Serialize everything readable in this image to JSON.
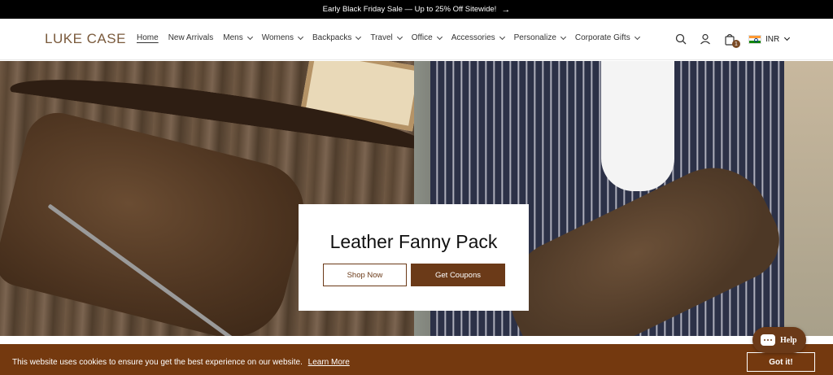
{
  "announcement": {
    "text": "Early Black Friday Sale — Up to 25% Off Sitewide!",
    "arrow": "→"
  },
  "header": {
    "logo": "LUKE CASE",
    "nav": [
      {
        "label": "Home",
        "active": true,
        "dropdown": false
      },
      {
        "label": "New Arrivals",
        "active": false,
        "dropdown": false
      },
      {
        "label": "Mens",
        "active": false,
        "dropdown": true
      },
      {
        "label": "Womens",
        "active": false,
        "dropdown": true
      },
      {
        "label": "Backpacks",
        "active": false,
        "dropdown": true
      },
      {
        "label": "Travel",
        "active": false,
        "dropdown": true
      },
      {
        "label": "Office",
        "active": false,
        "dropdown": true
      },
      {
        "label": "Accessories",
        "active": false,
        "dropdown": true
      },
      {
        "label": "Personalize",
        "active": false,
        "dropdown": true
      },
      {
        "label": "Corporate Gifts",
        "active": false,
        "dropdown": true
      }
    ],
    "icons": [
      "search-icon",
      "account-icon",
      "cart-icon"
    ],
    "cart_count": "1",
    "currency": "INR"
  },
  "hero": {
    "title": "Leather Fanny Pack",
    "primary_button": "Shop Now",
    "secondary_button": "Get Coupons"
  },
  "cookie_banner": {
    "text": "This website uses cookies to ensure you get the best experience on our website.",
    "link": "Learn More",
    "button": "Got it!"
  },
  "help_widget": {
    "label": "Help"
  },
  "colors": {
    "brand": "#6b3a18",
    "cookie_bg": "#74390f",
    "announce_bg": "#000000"
  }
}
